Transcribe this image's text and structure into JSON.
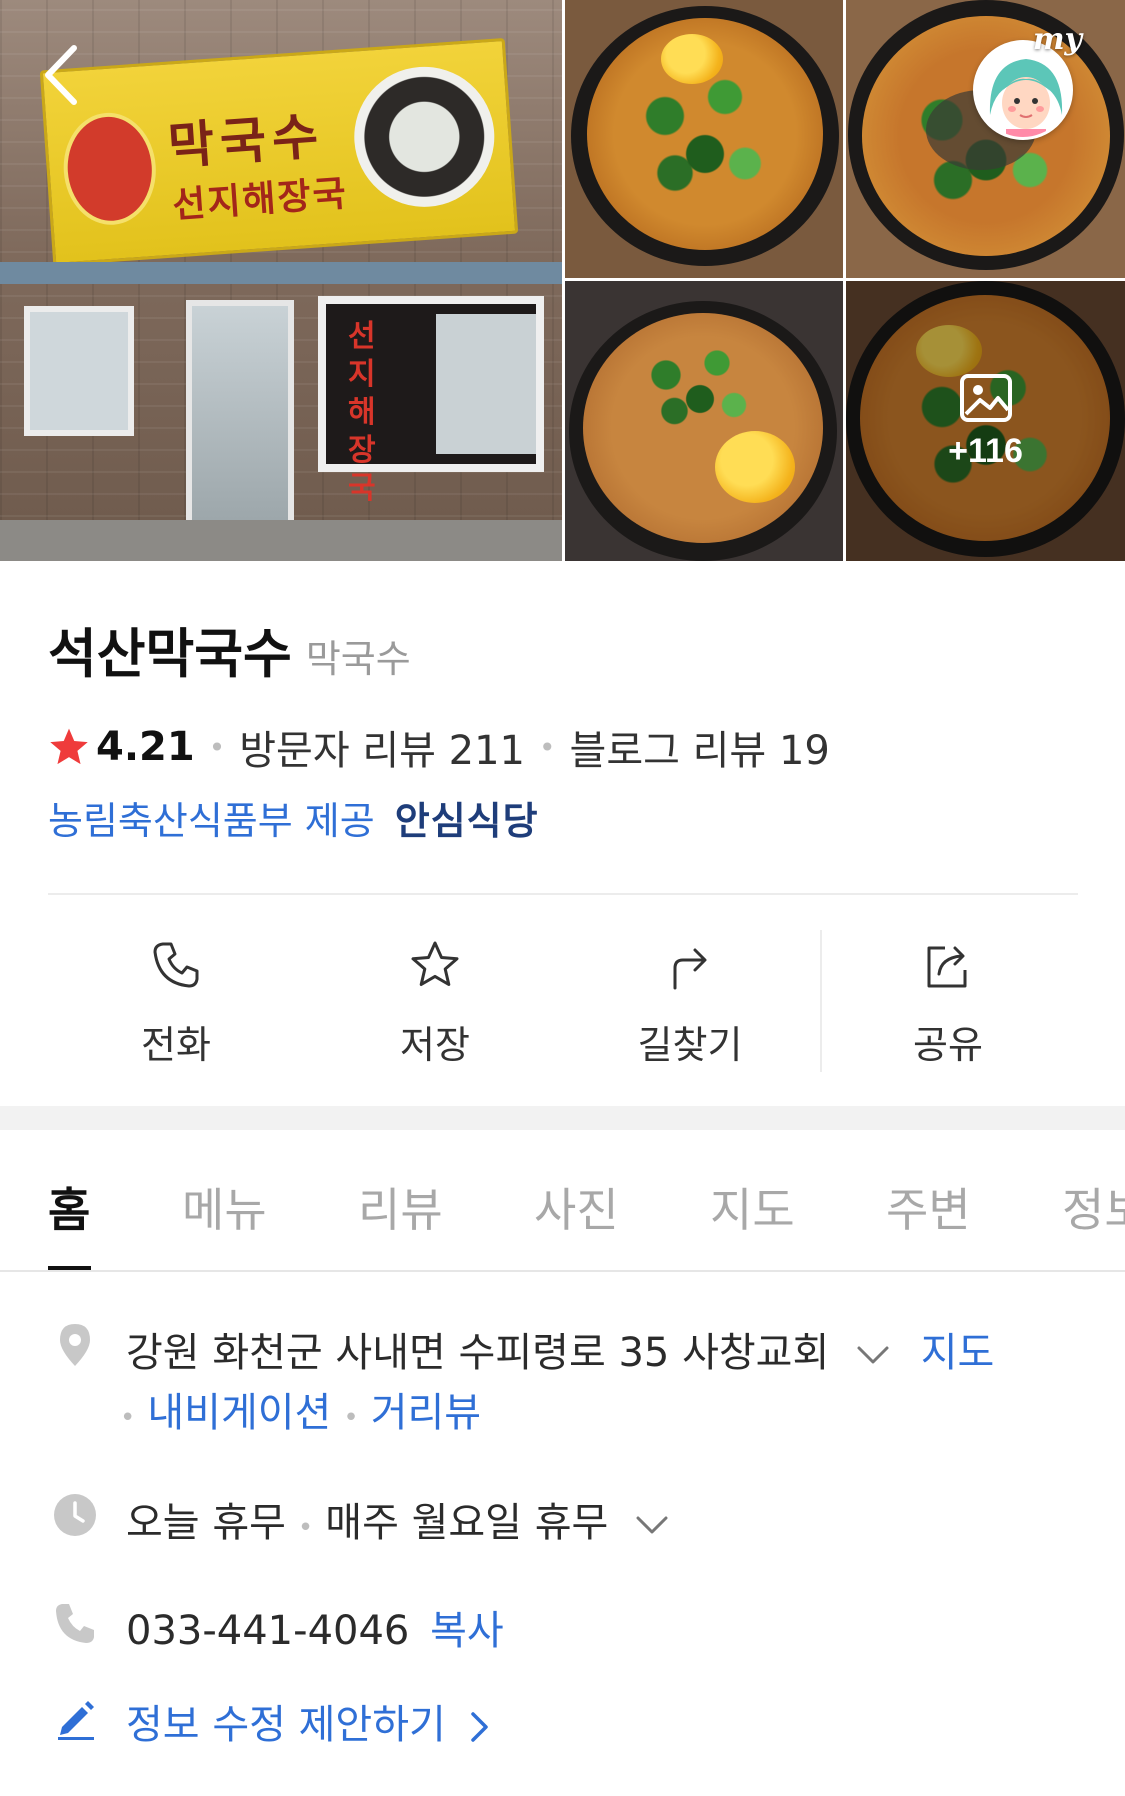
{
  "gallery": {
    "store_sign_main": "막국수",
    "store_sign_sub": "선지해장국",
    "store_window_text": "선지해장국",
    "more_photos_count": "+116",
    "my_label": "my"
  },
  "place": {
    "name": "석산막국수",
    "category": "막국수",
    "rating": "4.21",
    "visitor_reviews": "방문자 리뷰 211",
    "blog_reviews": "블로그 리뷰 19",
    "cert_provider": "농림축산식품부 제공",
    "cert_badge": "안심식당"
  },
  "actions": [
    {
      "label": "전화",
      "icon": "phone-icon"
    },
    {
      "label": "저장",
      "icon": "star-outline-icon"
    },
    {
      "label": "길찾기",
      "icon": "directions-icon"
    },
    {
      "label": "공유",
      "icon": "share-icon"
    }
  ],
  "tabs": [
    {
      "label": "홈",
      "active": true
    },
    {
      "label": "메뉴"
    },
    {
      "label": "리뷰"
    },
    {
      "label": "사진"
    },
    {
      "label": "지도"
    },
    {
      "label": "주변"
    },
    {
      "label": "정보"
    }
  ],
  "info": {
    "address": "강원 화천군 사내면 수피령로 35 사창교회",
    "map_link": "지도",
    "navigation_link": "내비게이션",
    "street_view_link": "거리뷰",
    "hours_status": "오늘 휴무",
    "hours_detail": "매주 월요일 휴무",
    "phone": "033-441-4046",
    "copy_label": "복사",
    "suggest_edit": "정보 수정 제안하기"
  },
  "colors": {
    "link_blue": "#2f6fd6",
    "star_red": "#ef3b3b",
    "badge_navy": "#1e3d7a"
  }
}
